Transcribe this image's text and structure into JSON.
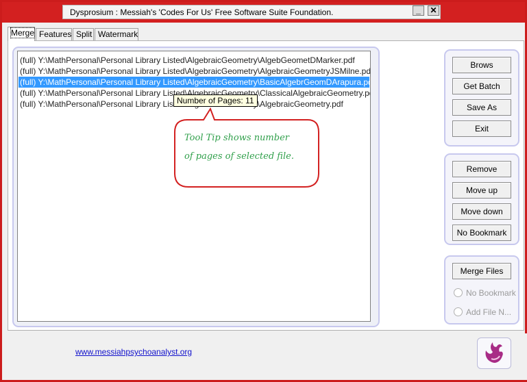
{
  "window": {
    "title": "Dysprosium : Messiah's 'Codes For Us' Free Software Suite Foundation.",
    "minimize_glyph": "_",
    "close_glyph": "✕"
  },
  "tabs": [
    {
      "label": "Merge",
      "active": true
    },
    {
      "label": "Features"
    },
    {
      "label": "Split"
    },
    {
      "label": "Watermark"
    }
  ],
  "files": [
    "(full) Y:\\MathPersonal\\Personal Library Listed\\AlgebraicGeometry\\AlgebGeometDMarker.pdf",
    "(full) Y:\\MathPersonal\\Personal Library Listed\\AlgebraicGeometry\\AlgebraicGeometryJSMilne.pdf",
    "(full) Y:\\MathPersonal\\Personal Library Listed\\AlgebraicGeometry\\BasicAlgebrGeomDArapura.pdf",
    "(full) Y:\\MathPersonal\\Personal Library Listed\\AlgebraicGeometry\\ClassicalAlgebraicGeometry.pdf",
    "(full) Y:\\MathPersonal\\Personal Library Listed\\AlgebraicGeometry\\AlgebraicGeometry.pdf"
  ],
  "selected_index": 2,
  "tooltip": "Number of Pages: 11",
  "callout": {
    "line1": "Tool Tip shows number",
    "line2": "of pages of selected file."
  },
  "buttons_top": {
    "browse": "Brows",
    "get_batch": "Get Batch",
    "save_as": "Save As",
    "exit": "Exit"
  },
  "buttons_mid": {
    "remove": "Remove",
    "move_up": "Move up",
    "move_down": "Move down",
    "no_bookmark": "No Bookmark"
  },
  "merge": {
    "merge_files": "Merge Files",
    "radio_no_bookmark": "No Bookmark",
    "radio_add_file_name": "Add File N..."
  },
  "footer": {
    "link": "www.messiahpsychoanalyst.org"
  },
  "colors": {
    "window_border": "#d32020",
    "selection": "#3399ff",
    "callout_text": "#2f9f4a",
    "callout_border": "#d32020"
  }
}
